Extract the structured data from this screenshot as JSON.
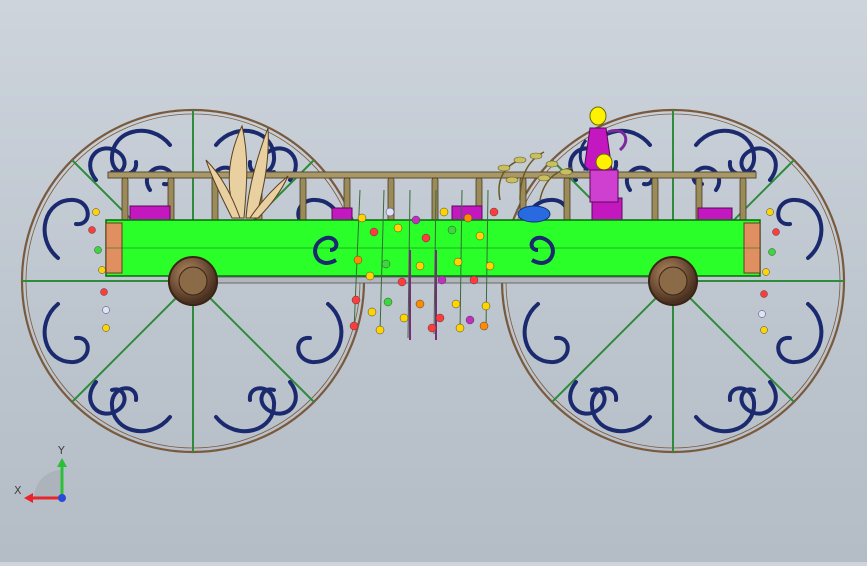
{
  "viewport": {
    "background_top": "#cdd4dc",
    "background_bottom": "#b4bcc6"
  },
  "model": {
    "frame_color": "#2aff2a",
    "wheel_rim_color": "#7a5a3c",
    "scroll_color": "#1b2a6e",
    "spoke_color": "#2e8b3a",
    "hub_color": "#6b4a30",
    "railing_color": "#9b8a5a",
    "planter_color": "#c318c0"
  },
  "triad": {
    "x_label": "X",
    "y_label": "Y",
    "x_color": "#e8262a",
    "y_color": "#2bbf3a",
    "z_color": "#2a4bd8",
    "icon": "coordinate-triad-icon"
  }
}
